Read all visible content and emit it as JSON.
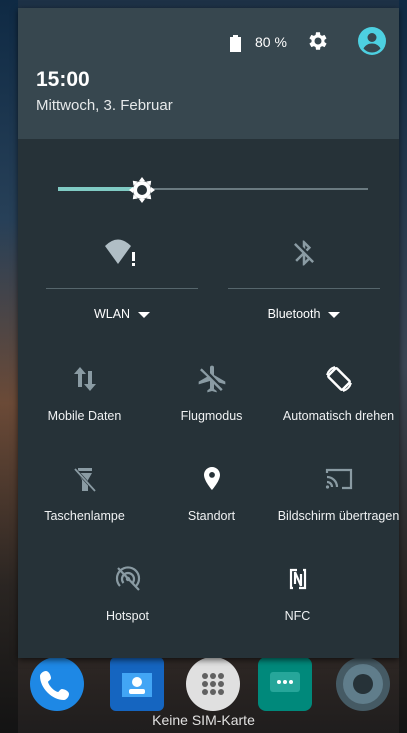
{
  "status": {
    "battery_percent": "80 %",
    "settings_icon": "gear-icon",
    "avatar_icon": "account-circle-icon",
    "accent_color": "#4dd0e1"
  },
  "header": {
    "time": "15:00",
    "date": "Mittwoch, 3. Februar"
  },
  "brightness": {
    "icon": "brightness-icon",
    "level": 0.27
  },
  "big_tiles": [
    {
      "label": "WLAN",
      "icon": "wifi-alert-icon",
      "expandable": true
    },
    {
      "label": "Bluetooth",
      "icon": "bluetooth-disabled-icon",
      "expandable": true
    }
  ],
  "tiles": [
    {
      "label": "Mobile Daten",
      "icon": "mobile-data-icon",
      "active": false
    },
    {
      "label": "Flugmodus",
      "icon": "airplane-off-icon",
      "active": false
    },
    {
      "label": "Automatisch drehen",
      "icon": "auto-rotate-icon",
      "active": true
    },
    {
      "label": "Taschenlampe",
      "icon": "flashlight-off-icon",
      "active": false
    },
    {
      "label": "Standort",
      "icon": "location-icon",
      "active": true
    },
    {
      "label": "Bildschirm übertragen",
      "icon": "cast-icon",
      "active": false
    },
    {
      "label": "Hotspot",
      "icon": "hotspot-off-icon",
      "active": false
    },
    {
      "label": "NFC",
      "icon": "nfc-icon",
      "active": true
    }
  ],
  "dock": {
    "apps": [
      "phone-icon",
      "contacts-icon",
      "app-drawer-icon",
      "messages-icon",
      "camera-icon"
    ]
  },
  "footer": {
    "sim_status": "Keine SIM-Karte"
  }
}
